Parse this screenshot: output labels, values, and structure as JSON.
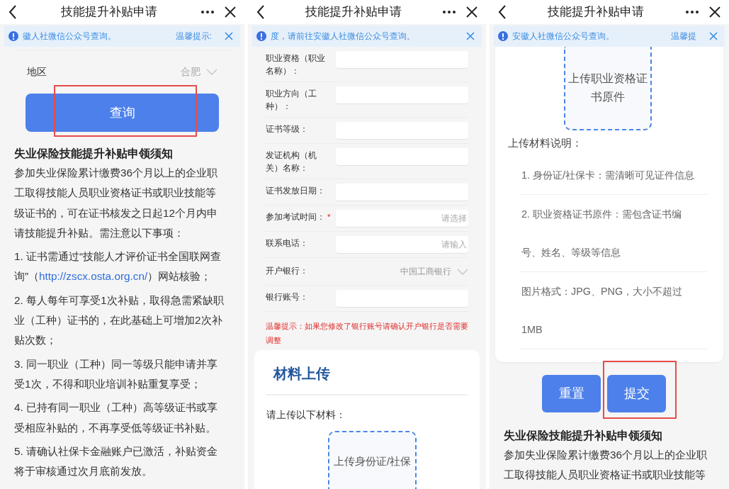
{
  "panels": [
    {
      "title": "技能提升补贴申请",
      "notice": {
        "text": "徽人社微信公众号查询。",
        "hint": "温馨提示:"
      },
      "blocks": [
        {
          "kind": "select",
          "label": "地区",
          "value": "合肥"
        },
        {
          "kind": "button",
          "label": "查询",
          "highlighted": true
        },
        {
          "kind": "heading",
          "text": "失业保险技能提升补贴申领须知"
        },
        {
          "kind": "paragraph",
          "text": "参加失业保险累计缴费36个月以上的企业职工取得技能人员职业资格证书或职业技能等级证书的，可在证书核发之日起12个月内申请技能提升补贴。需注意以下事项："
        },
        {
          "kind": "paragraph",
          "text": "1. 证书需通过“技能人才评价证书全国联网查询”（",
          "link": "http://zscx.osta.org.cn/",
          "after": "）网站核验；"
        },
        {
          "kind": "paragraph",
          "text": "2. 每人每年可享受1次补贴，取得急需紧缺职业（工种）证书的，在此基础上可增加2次补贴次数；"
        },
        {
          "kind": "paragraph",
          "text": "3. 同一职业（工种）同一等级只能申请并享受1次，不得和职业培训补贴重复享受；"
        },
        {
          "kind": "paragraph",
          "text": "4. 已持有同一职业（工种）高等级证书或享受相应补贴的，不再享受低等级证书补贴。"
        },
        {
          "kind": "paragraph",
          "text": "5. 请确认社保卡金融账户已激活，补贴资金将于审核通过次月底前发放。"
        }
      ]
    },
    {
      "title": "技能提升补贴申请",
      "notice": {
        "text": "度，请前往安徽人社微信公众号查询。"
      },
      "blocks": [
        {
          "kind": "field",
          "label": "职业资格（职业名称）："
        },
        {
          "kind": "field",
          "label": "职业方向（工种）："
        },
        {
          "kind": "field",
          "label": "证书等级："
        },
        {
          "kind": "field",
          "label": "发证机构（机关）名称："
        },
        {
          "kind": "field",
          "label": "证书发放日期："
        },
        {
          "kind": "field",
          "label": "参加考试时间：",
          "required_mark": "*",
          "placeholder": "请选择"
        },
        {
          "kind": "field",
          "label": "联系电话：",
          "placeholder": "请输入"
        },
        {
          "kind": "select_row",
          "label": "开户银行：",
          "value": "中国工商银行"
        },
        {
          "kind": "field",
          "label": "银行账号："
        },
        {
          "kind": "warning",
          "text": "温馨提示：如果您修改了银行账号请确认开户银行是否需要调整"
        },
        {
          "kind": "card",
          "title": "材料上传",
          "subtitle": "请上传以下材料：",
          "uploads": [
            "上传身份证/社保"
          ]
        }
      ]
    },
    {
      "title": "技能提升补贴申请",
      "notice": {
        "text": "安徽人社微信公众号查询。",
        "hint": "温馨提"
      },
      "blocks": [
        {
          "kind": "card_tail",
          "uploads": [
            "上传职业资格证书原件"
          ],
          "notes_title": "上传材料说明：",
          "notes": [
            "1. 身份证/社保卡：需清晰可见证件信息",
            "2. 职业资格证书原件：需包含证书编号、姓名、等级等信息",
            "图片格式：JPG、PNG，大小不超过1MB"
          ]
        },
        {
          "kind": "buttons",
          "items": [
            {
              "label": "重置",
              "highlighted": false
            },
            {
              "label": "提交",
              "highlighted": true
            }
          ]
        },
        {
          "kind": "heading",
          "text": "失业保险技能提升补贴申领须知"
        },
        {
          "kind": "paragraph",
          "text": "参加失业保险累计缴费36个月以上的企业职工取得技能人员职业资格证书或职业技能等"
        }
      ]
    }
  ]
}
